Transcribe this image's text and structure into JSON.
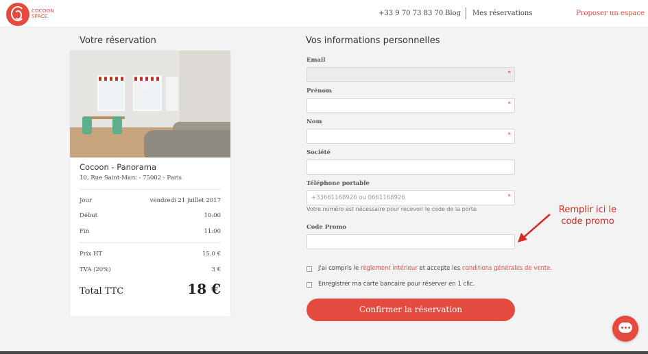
{
  "header": {
    "brand_line1": "COCOON",
    "brand_line2": "SPACE",
    "phone": "+33 9 70 73 83 70",
    "blog": "Blog",
    "reservations": "Mes réservations",
    "propose": "Proposer un espace"
  },
  "left": {
    "heading": "Votre réservation",
    "room_name": "Cocoon - Panorama",
    "room_address": "10, Rue Saint-Marc - 75002 - Paris",
    "rows": [
      {
        "label": "Jour",
        "value": "vendredi 21 juillet 2017"
      },
      {
        "label": "Début",
        "value": "10:00"
      },
      {
        "label": "Fin",
        "value": "11:00"
      },
      {
        "label": "Prix HT",
        "value": "15.0 €"
      },
      {
        "label": "TVA (20%)",
        "value": "3 €"
      }
    ],
    "total_label": "Total TTC",
    "total_value": "18 €"
  },
  "form": {
    "heading": "Vos informations personnelles",
    "fields": [
      {
        "label": "Email",
        "placeholder": "",
        "required": "*"
      },
      {
        "label": "Prénom",
        "placeholder": "",
        "required": "*"
      },
      {
        "label": "Nom",
        "placeholder": "",
        "required": "*"
      },
      {
        "label": "Société",
        "placeholder": "",
        "required": ""
      },
      {
        "label": "Téléphone portable",
        "placeholder": "+33661168926 ou 0661168926",
        "required": "*"
      },
      {
        "label": "Code Promo",
        "placeholder": "",
        "required": ""
      }
    ],
    "phone_hint": "Votre numéro est nécessaire pour recevoir le code de la porte",
    "terms_prefix": "J'ai compris le ",
    "terms_link1": "règlement intérieur",
    "terms_middle": " et accepte les ",
    "terms_link2": "conditions générales de vente",
    "terms_suffix": ".",
    "save_card": "Enregistrer ma carte bancaire pour réserver en 1 clic.",
    "confirm": "Confirmer la réservation"
  },
  "annotation": {
    "line1": "Remplir ici le",
    "line2": "code promo"
  },
  "colors": {
    "accent": "#e44a3e",
    "annotation": "#d42a1f",
    "background": "#f3f3f3"
  }
}
